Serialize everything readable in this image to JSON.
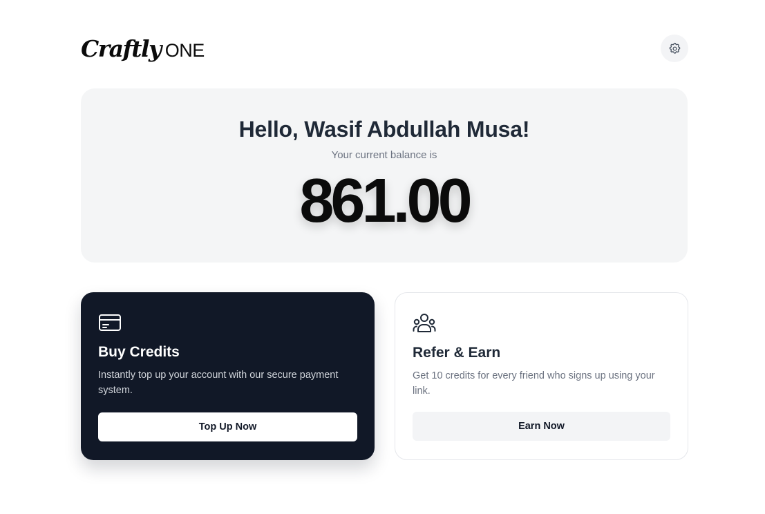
{
  "brand": {
    "script": "Craftly",
    "word": "ONE"
  },
  "header": {
    "settings_icon": "gear-icon"
  },
  "balance": {
    "greeting": "Hello, Wasif Abdullah Musa!",
    "label": "Your current balance is",
    "amount": "861.00"
  },
  "cards": {
    "buy": {
      "icon": "credit-card-icon",
      "title": "Buy Credits",
      "description": "Instantly top up your account with our secure payment system.",
      "button_label": "Top Up Now"
    },
    "refer": {
      "icon": "users-group-icon",
      "title": "Refer & Earn",
      "description": "Get 10 credits for every friend who signs up using your link.",
      "button_label": "Earn Now"
    }
  },
  "colors": {
    "dark_card": "#111827",
    "balance_bg": "#f4f5f6",
    "muted_text": "#6b7280"
  }
}
